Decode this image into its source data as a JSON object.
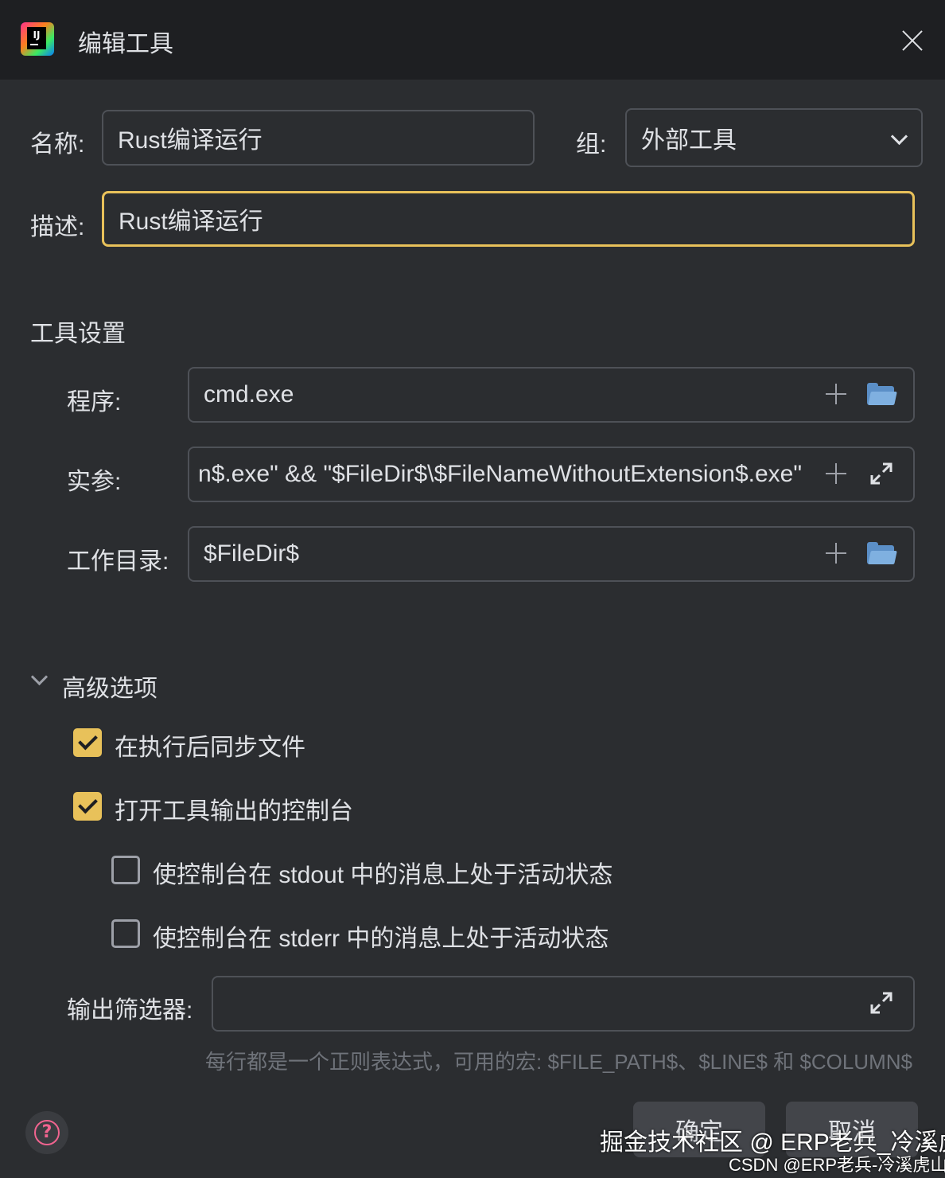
{
  "window": {
    "title": "编辑工具"
  },
  "form": {
    "name_label": "名称:",
    "name_value": "Rust编译运行",
    "group_label": "组:",
    "group_value": "外部工具",
    "description_label": "描述:",
    "description_value": "Rust编译运行"
  },
  "tool_settings": {
    "section_title": "工具设置",
    "program_label": "程序:",
    "program_value": "cmd.exe",
    "arguments_label": "实参:",
    "arguments_value": "n$.exe\" && \"$FileDir$\\$FileNameWithoutExtension$.exe\"",
    "workdir_label": "工作目录:",
    "workdir_value": "$FileDir$"
  },
  "advanced": {
    "section_title": "高级选项",
    "sync_files_label": "在执行后同步文件",
    "sync_files_checked": true,
    "open_console_label": "打开工具输出的控制台",
    "open_console_checked": true,
    "stdout_active_label": "使控制台在 stdout 中的消息上处于活动状态",
    "stdout_active_checked": false,
    "stderr_active_label": "使控制台在 stderr 中的消息上处于活动状态",
    "stderr_active_checked": false,
    "output_filter_label": "输出筛选器:",
    "output_filter_value": "",
    "hint": "每行都是一个正则表达式，可用的宏: $FILE_PATH$、$LINE$ 和 $COLUMN$"
  },
  "buttons": {
    "ok": "确定",
    "cancel": "取消"
  },
  "watermarks": {
    "juejin": "掘金技术社区 @ ERP老兵_冷溪虎山",
    "csdn": "CSDN @ERP老兵-冷溪虎山"
  },
  "colors": {
    "accent": "#e8c15a",
    "background": "#2b2d30",
    "titlebar": "#1e1f22"
  }
}
